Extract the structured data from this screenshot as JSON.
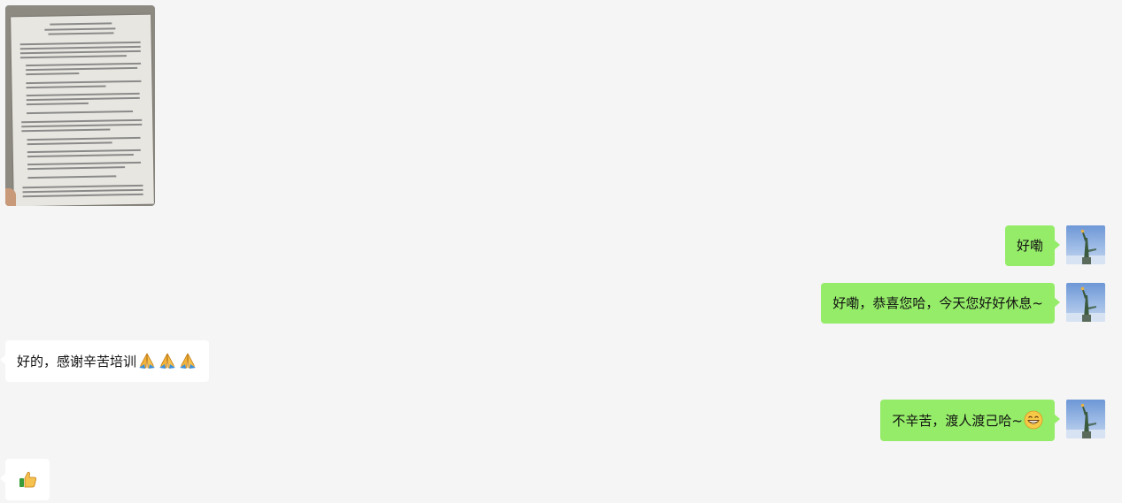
{
  "messages": [
    {
      "side": "left",
      "type": "image",
      "icon": "document-photo"
    },
    {
      "side": "right",
      "text": "好嘞"
    },
    {
      "side": "right",
      "text": "好嘞，恭喜您哈，今天您好好休息~"
    },
    {
      "side": "left",
      "text": "好的，感谢辛苦培训",
      "emojis": [
        "folded-hands-icon",
        "folded-hands-icon",
        "folded-hands-icon"
      ]
    },
    {
      "side": "right",
      "text": "不辛苦，渡人渡己哈~",
      "emojis": [
        "grinning-face-icon"
      ]
    },
    {
      "side": "left",
      "text": "",
      "emojis": [
        "thumbs-up-icon"
      ]
    }
  ],
  "colors": {
    "background": "#f5f5f5",
    "my_bubble": "#95ec69",
    "their_bubble": "#ffffff"
  }
}
